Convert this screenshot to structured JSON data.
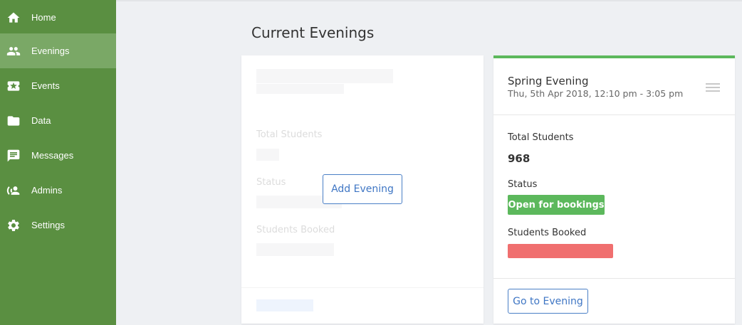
{
  "sidebar": {
    "items": [
      {
        "label": "Home",
        "icon": "home-icon"
      },
      {
        "label": "Evenings",
        "icon": "people-icon",
        "active": true
      },
      {
        "label": "Events",
        "icon": "ticket-icon"
      },
      {
        "label": "Data",
        "icon": "folder-icon"
      },
      {
        "label": "Messages",
        "icon": "message-icon"
      },
      {
        "label": "Admins",
        "icon": "admins-icon"
      },
      {
        "label": "Settings",
        "icon": "gear-icon"
      }
    ]
  },
  "page": {
    "title": "Current Evenings"
  },
  "placeholder_card": {
    "labels": {
      "total_students": "Total Students",
      "status": "Status",
      "students_booked": "Students Booked"
    },
    "add_button": "Add Evening"
  },
  "evening_card": {
    "title": "Spring Evening",
    "date": "Thu, 5th Apr 2018, 12:10 pm - 3:05 pm",
    "total_students_label": "Total Students",
    "total_students": "968",
    "status_label": "Status",
    "status": "Open for bookings",
    "students_booked_label": "Students Booked",
    "booked_fraction": 1.0,
    "go_button": "Go to Evening"
  },
  "colors": {
    "sidebar": "#5a8f41",
    "sidebar_active": "#7aa866",
    "accent_green": "#5cb85c",
    "booked_red": "#f06f6f",
    "button_blue": "#3f76c4"
  }
}
